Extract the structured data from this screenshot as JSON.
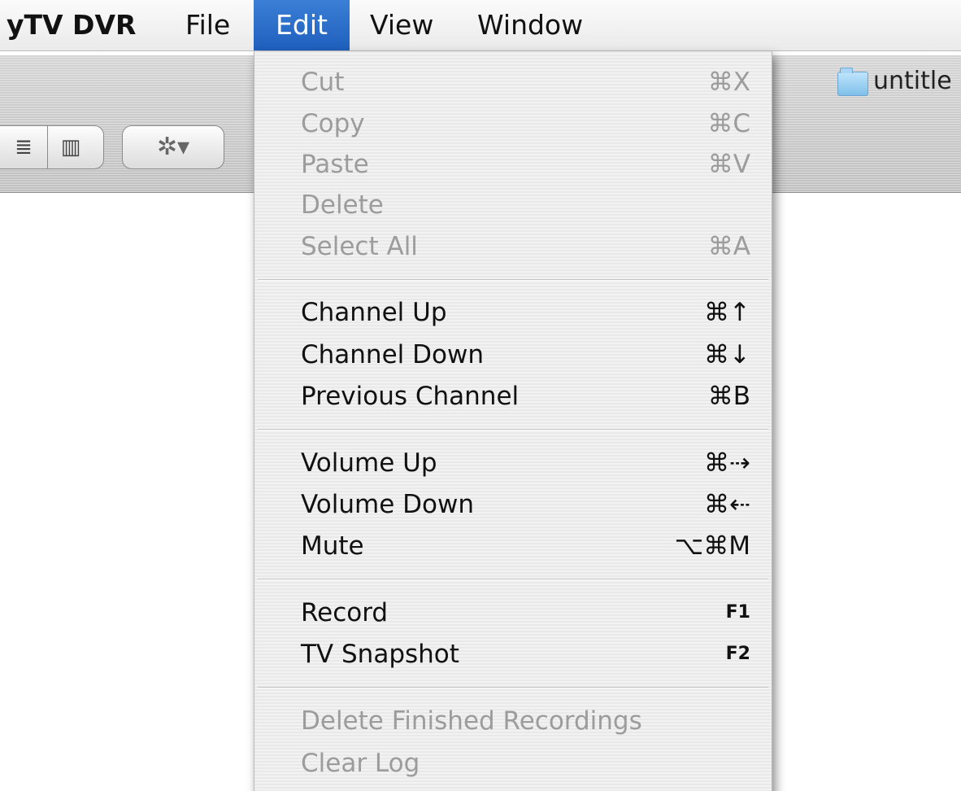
{
  "menubar": {
    "app_name": "yTV DVR",
    "file": "File",
    "edit": "Edit",
    "view": "View",
    "window": "Window"
  },
  "toolbar": {
    "window_title": "untitle",
    "list_view_glyph": "≣",
    "column_view_glyph": "▥",
    "action_glyph": "✲▾"
  },
  "edit_menu": {
    "items": [
      {
        "label": "Cut",
        "shortcut": "⌘X",
        "enabled": false
      },
      {
        "label": "Copy",
        "shortcut": "⌘C",
        "enabled": false
      },
      {
        "label": "Paste",
        "shortcut": "⌘V",
        "enabled": false
      },
      {
        "label": "Delete",
        "shortcut": "",
        "enabled": false
      },
      {
        "label": "Select All",
        "shortcut": "⌘A",
        "enabled": false
      },
      {
        "label": "Channel Up",
        "shortcut": "⌘↑",
        "enabled": true
      },
      {
        "label": "Channel Down",
        "shortcut": "⌘↓",
        "enabled": true
      },
      {
        "label": "Previous Channel",
        "shortcut": "⌘B",
        "enabled": true
      },
      {
        "label": "Volume Up",
        "shortcut": "⌘⇢",
        "enabled": true
      },
      {
        "label": "Volume Down",
        "shortcut": "⌘⇠",
        "enabled": true
      },
      {
        "label": "Mute",
        "shortcut": "⌥⌘M",
        "enabled": true
      },
      {
        "label": "Record",
        "shortcut": "F1",
        "enabled": true
      },
      {
        "label": "TV Snapshot",
        "shortcut": "F2",
        "enabled": true
      },
      {
        "label": "Delete Finished Recordings",
        "shortcut": "",
        "enabled": false
      },
      {
        "label": "Clear Log",
        "shortcut": "",
        "enabled": false
      }
    ]
  },
  "colors": {
    "menu_highlight": "#1e5fbd",
    "disabled_text": "#9c9c9c"
  }
}
